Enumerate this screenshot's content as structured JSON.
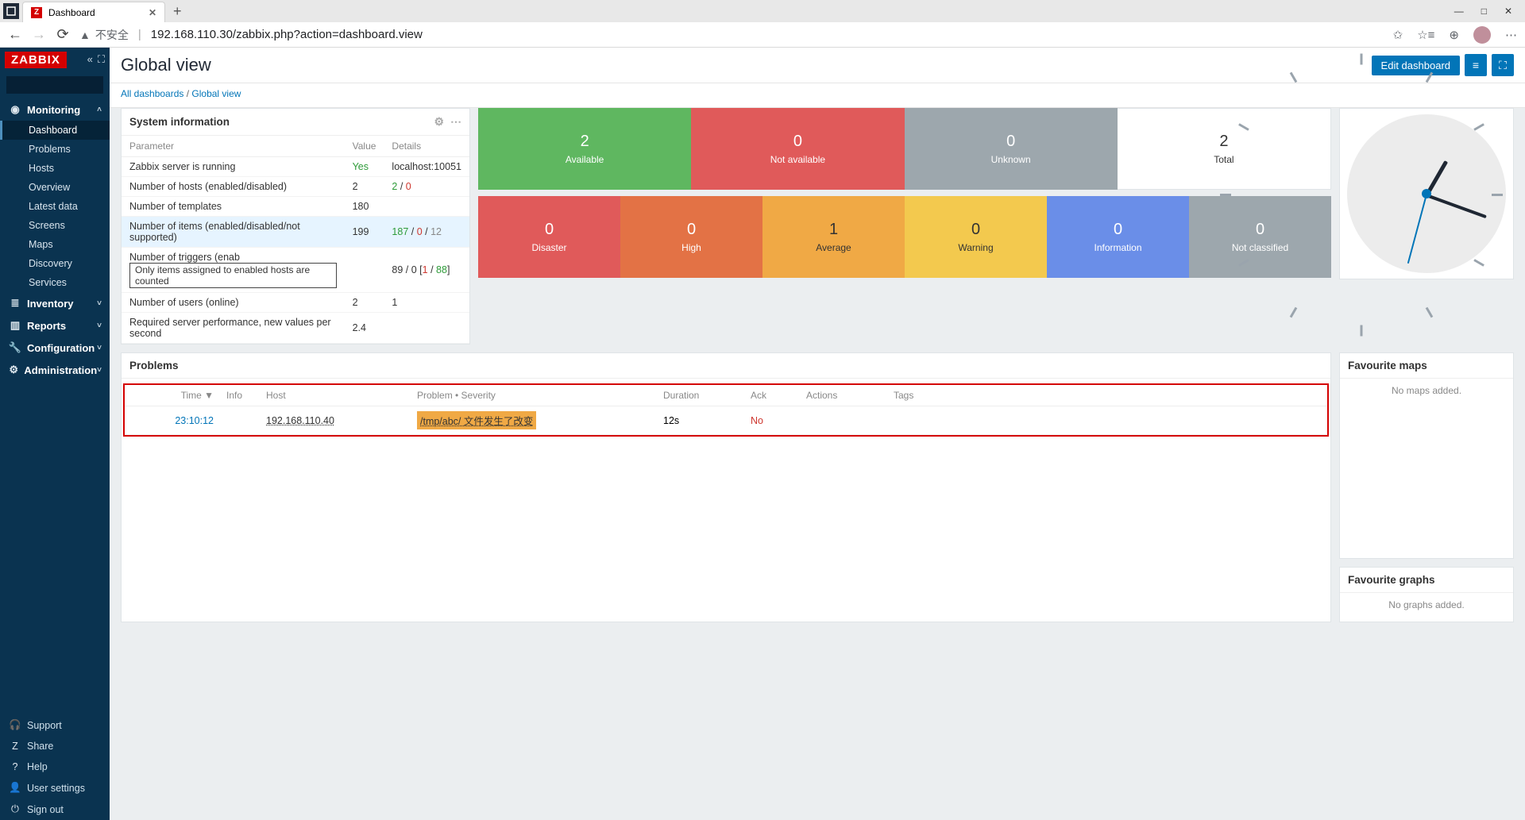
{
  "browser": {
    "tabTitle": "Dashboard",
    "securityLabel": "不安全",
    "url": "192.168.110.30/zabbix.php?action=dashboard.view"
  },
  "sidebar": {
    "logo": "ZABBIX",
    "sections": {
      "monitoring": {
        "label": "Monitoring",
        "items": [
          "Dashboard",
          "Problems",
          "Hosts",
          "Overview",
          "Latest data",
          "Screens",
          "Maps",
          "Discovery",
          "Services"
        ]
      },
      "inventory": {
        "label": "Inventory"
      },
      "reports": {
        "label": "Reports"
      },
      "configuration": {
        "label": "Configuration"
      },
      "administration": {
        "label": "Administration"
      }
    },
    "footer": [
      "Support",
      "Share",
      "Help",
      "User settings",
      "Sign out"
    ]
  },
  "header": {
    "title": "Global view",
    "editBtn": "Edit dashboard"
  },
  "breadcrumb": {
    "all": "All dashboards",
    "current": "Global view"
  },
  "sysinfo": {
    "title": "System information",
    "cols": [
      "Parameter",
      "Value",
      "Details"
    ],
    "rows": [
      {
        "p": "Zabbix server is running",
        "v": "Yes",
        "vClass": "green",
        "d": "localhost:10051"
      },
      {
        "p": "Number of hosts (enabled/disabled)",
        "v": "2",
        "d": "2 / 0",
        "dHtml": "<span class='green'>2</span> / <span class='red'>0</span>"
      },
      {
        "p": "Number of templates",
        "v": "180",
        "d": ""
      },
      {
        "p": "Number of items (enabled/disabled/not supported)",
        "v": "199",
        "d": "187 / 0 / 12",
        "dHtml": "<span class='green'>187</span> / <span class='red'>0</span> / <span class='gray'>12</span>",
        "hl": true
      },
      {
        "p": "Number of triggers (enab",
        "tooltip": "Only items assigned to enabled hosts are counted",
        "v": "",
        "d": "89 / 0 [1 / 88]",
        "dHtml": "89 / 0 [<span class='red'>1</span> / <span class='green'>88</span>]"
      },
      {
        "p": "Number of users (online)",
        "v": "2",
        "d": "1"
      },
      {
        "p": "Required server performance, new values per second",
        "v": "2.4",
        "d": ""
      }
    ]
  },
  "tiles": {
    "row1": [
      {
        "num": "2",
        "lbl": "Available",
        "cls": "t-avail"
      },
      {
        "num": "0",
        "lbl": "Not available",
        "cls": "t-unavail"
      },
      {
        "num": "0",
        "lbl": "Unknown",
        "cls": "t-unknown"
      },
      {
        "num": "2",
        "lbl": "Total",
        "cls": "t-total"
      }
    ],
    "row2": [
      {
        "num": "0",
        "lbl": "Disaster",
        "cls": "t-disaster"
      },
      {
        "num": "0",
        "lbl": "High",
        "cls": "t-high"
      },
      {
        "num": "1",
        "lbl": "Average",
        "cls": "t-average"
      },
      {
        "num": "0",
        "lbl": "Warning",
        "cls": "t-warning"
      },
      {
        "num": "0",
        "lbl": "Information",
        "cls": "t-info"
      },
      {
        "num": "0",
        "lbl": "Not classified",
        "cls": "t-notclass"
      }
    ]
  },
  "problems": {
    "title": "Problems",
    "cols": [
      "Time ▼",
      "Info",
      "Host",
      "Problem • Severity",
      "Duration",
      "Ack",
      "Actions",
      "Tags"
    ],
    "rows": [
      {
        "time": "23:10:12",
        "info": "",
        "host": "192.168.110.40",
        "problem": "/tmp/abc/ 文件发生了改变",
        "duration": "12s",
        "ack": "No",
        "actions": "",
        "tags": ""
      }
    ]
  },
  "favMaps": {
    "title": "Favourite maps",
    "empty": "No maps added."
  },
  "favGraphs": {
    "title": "Favourite graphs",
    "empty": "No graphs added."
  }
}
